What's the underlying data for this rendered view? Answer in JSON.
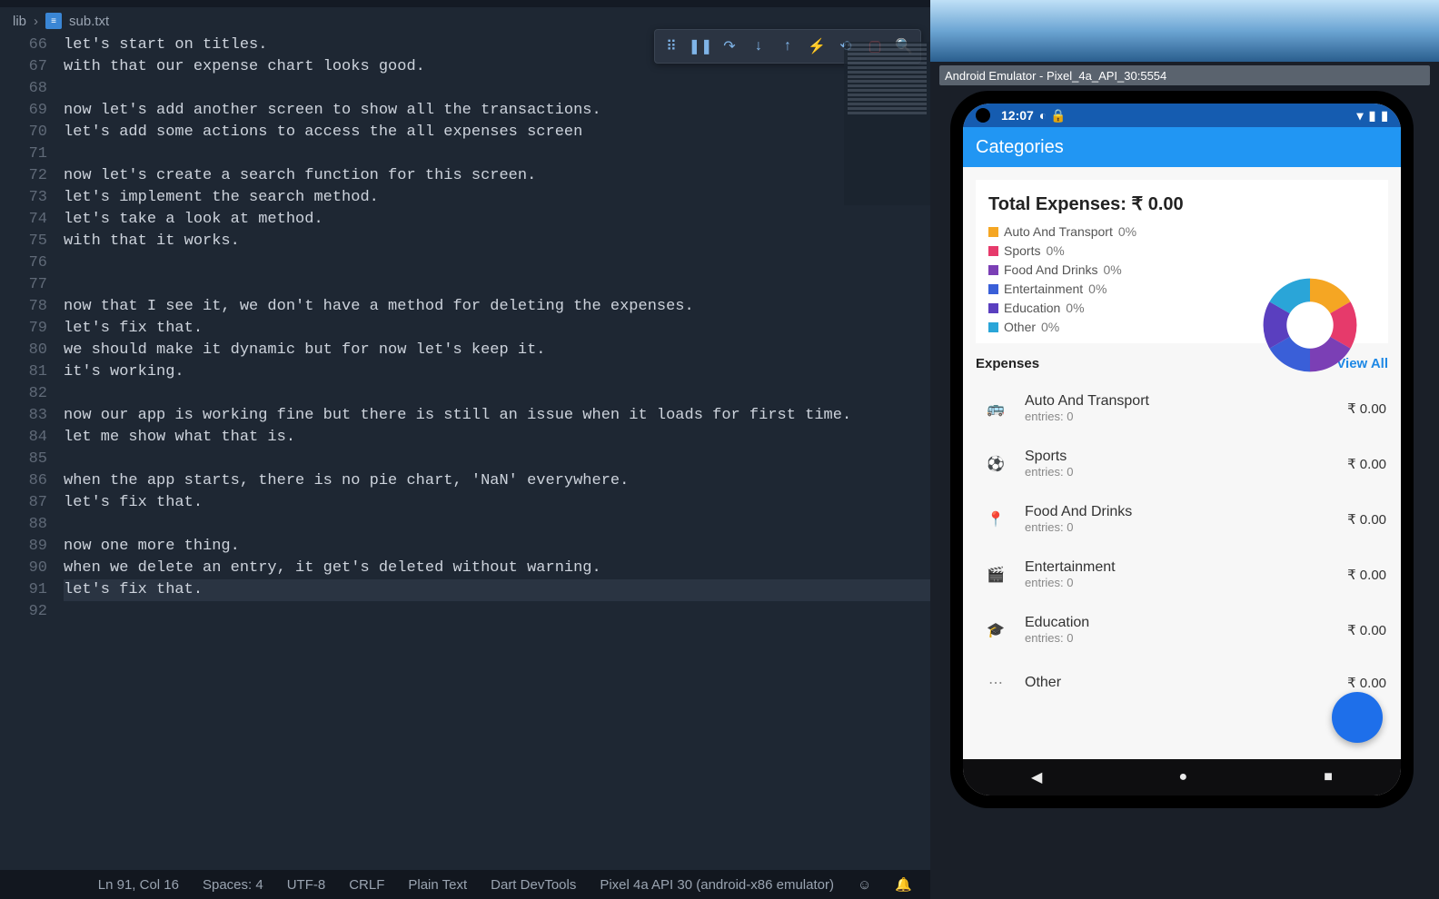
{
  "editor": {
    "tab_name": "sub.txt",
    "breadcrumb": {
      "folder": "lib",
      "file": "sub.txt"
    },
    "lines": [
      {
        "n": 66,
        "t": "let's start on titles."
      },
      {
        "n": 67,
        "t": "with that our expense chart looks good."
      },
      {
        "n": 68,
        "t": ""
      },
      {
        "n": 69,
        "t": "now let's add another screen to show all the transactions."
      },
      {
        "n": 70,
        "t": "let's add some actions to access the all expenses screen"
      },
      {
        "n": 71,
        "t": ""
      },
      {
        "n": 72,
        "t": "now let's create a search function for this screen."
      },
      {
        "n": 73,
        "t": "let's implement the search method."
      },
      {
        "n": 74,
        "t": "let's take a look at method."
      },
      {
        "n": 75,
        "t": "with that it works."
      },
      {
        "n": 76,
        "t": ""
      },
      {
        "n": 77,
        "t": ""
      },
      {
        "n": 78,
        "t": "now that I see it, we don't have a method for deleting the expenses."
      },
      {
        "n": 79,
        "t": "let's fix that."
      },
      {
        "n": 80,
        "t": "we should make it dynamic but for now let's keep it."
      },
      {
        "n": 81,
        "t": "it's working."
      },
      {
        "n": 82,
        "t": ""
      },
      {
        "n": 83,
        "t": "now our app is working fine but there is still an issue when it loads for first time."
      },
      {
        "n": 84,
        "t": "let me show what that is."
      },
      {
        "n": 85,
        "t": ""
      },
      {
        "n": 86,
        "t": "when the app starts, there is no pie chart, 'NaN' everywhere."
      },
      {
        "n": 87,
        "t": "let's fix that."
      },
      {
        "n": 88,
        "t": ""
      },
      {
        "n": 89,
        "t": "now one more thing."
      },
      {
        "n": 90,
        "t": "when we delete an entry, it get's deleted without warning."
      },
      {
        "n": 91,
        "t": "let's fix that."
      },
      {
        "n": 92,
        "t": ""
      }
    ],
    "active_line": 91
  },
  "status_bar": {
    "ln_col": "Ln 91, Col 16",
    "spaces": "Spaces: 4",
    "encoding": "UTF-8",
    "eol": "CRLF",
    "lang": "Plain Text",
    "devtools": "Dart DevTools",
    "device": "Pixel 4a API 30 (android-x86 emulator)"
  },
  "emulator": {
    "title": "Android Emulator - Pixel_4a_API_30:5554",
    "clock": "12:07",
    "app_title": "Categories",
    "total_label": "Total Expenses: ",
    "total_value": "₹ 0.00",
    "legend": [
      {
        "name": "Auto And Transport",
        "pct": "0%",
        "color": "#f5a623"
      },
      {
        "name": "Sports",
        "pct": "0%",
        "color": "#e63a6b"
      },
      {
        "name": "Food And Drinks",
        "pct": "0%",
        "color": "#7b3fb5"
      },
      {
        "name": "Entertainment",
        "pct": "0%",
        "color": "#3a5fd8"
      },
      {
        "name": "Education",
        "pct": "0%",
        "color": "#5a3fbf"
      },
      {
        "name": "Other",
        "pct": "0%",
        "color": "#2aa5d8"
      }
    ],
    "expenses_label": "Expenses",
    "viewall_label": "View All",
    "expenses": [
      {
        "icon": "train",
        "name": "Auto And Transport",
        "entries": "entries: 0",
        "amount": "₹ 0.00"
      },
      {
        "icon": "ball",
        "name": "Sports",
        "entries": "entries: 0",
        "amount": "₹ 0.00"
      },
      {
        "icon": "pin",
        "name": "Food And Drinks",
        "entries": "entries: 0",
        "amount": "₹ 0.00"
      },
      {
        "icon": "movie",
        "name": "Entertainment",
        "entries": "entries: 0",
        "amount": "₹ 0.00"
      },
      {
        "icon": "school",
        "name": "Education",
        "entries": "entries: 0",
        "amount": "₹ 0.00"
      },
      {
        "icon": "more",
        "name": "Other",
        "entries": "",
        "amount": "₹ 0.00"
      }
    ]
  },
  "chart_data": {
    "type": "pie",
    "title": "Total Expenses: ₹ 0.00",
    "categories": [
      "Auto And Transport",
      "Sports",
      "Food And Drinks",
      "Entertainment",
      "Education",
      "Other"
    ],
    "values": [
      0,
      0,
      0,
      0,
      0,
      0
    ],
    "colors": [
      "#f5a623",
      "#e63a6b",
      "#7b3fb5",
      "#3a5fd8",
      "#5a3fbf",
      "#2aa5d8"
    ]
  }
}
